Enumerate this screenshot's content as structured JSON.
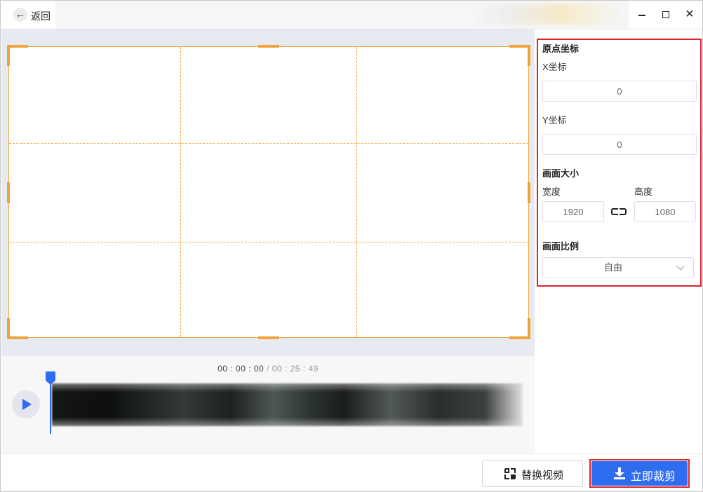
{
  "header": {
    "back_label": "返回",
    "back_icon": "arrow-left-icon",
    "window_controls": [
      "minimize-icon",
      "maximize-icon",
      "close-icon"
    ]
  },
  "timeline": {
    "current_time": "00 : 00 : 00",
    "separator": "/",
    "total_time": "00 : 25 : 49",
    "playhead_position_fraction": 0.0
  },
  "panel": {
    "origin_title": "原点坐标",
    "x_label": "X坐标",
    "x_value": "0",
    "y_label": "Y坐标",
    "y_value": "0",
    "size_title": "画面大小",
    "width_label": "宽度",
    "width_value": "1920",
    "height_label": "高度",
    "height_value": "1080",
    "ratio_title": "画面比例",
    "ratio_value": "自由"
  },
  "footer": {
    "replace_label": "替换视频",
    "crop_label": "立即裁剪"
  },
  "colors": {
    "accent": "#2f6df0",
    "crop_frame": "#f0a33a",
    "highlight": "#d9252e",
    "preview_bg": "#e7eaf0"
  }
}
